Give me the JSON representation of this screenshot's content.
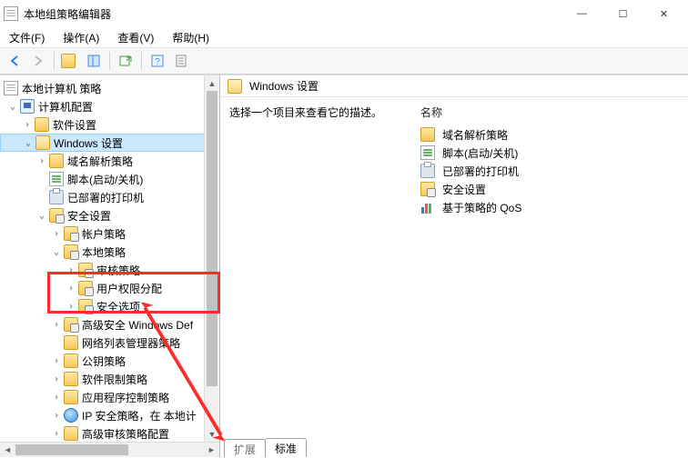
{
  "window": {
    "title": "本地组策略编辑器"
  },
  "menu": {
    "file": "文件(F)",
    "action": "操作(A)",
    "view": "查看(V)",
    "help": "帮助(H)"
  },
  "winctrl": {
    "min": "—",
    "max": "☐",
    "close": "✕"
  },
  "tree": {
    "root": "本地计算机 策略",
    "computer_config": "计算机配置",
    "software_settings": "软件设置",
    "windows_settings": "Windows 设置",
    "dns_policy": "域名解析策略",
    "scripts": "脚本(启动/关机)",
    "deployed_printers": "已部署的打印机",
    "security_settings": "安全设置",
    "account_policies": "帐户策略",
    "local_policies": "本地策略",
    "audit_policy": "审核策略",
    "user_rights": "用户权限分配",
    "security_options": "安全选项",
    "wfas": "高级安全 Windows Def",
    "nlm": "网络列表管理器策略",
    "pki": "公钥策略",
    "srp": "软件限制策略",
    "applocker": "应用程序控制策略",
    "ipsec": "IP 安全策略，在 本地计",
    "adv_audit": "高级审核策略配置"
  },
  "content": {
    "header": "Windows 设置",
    "hint": "选择一个项目来查看它的描述。",
    "col_name": "名称",
    "items": {
      "dns": "域名解析策略",
      "scripts": "脚本(启动/关机)",
      "printers": "已部署的打印机",
      "security": "安全设置",
      "qos": "基于策略的 QoS"
    }
  },
  "tabs": {
    "extended": "扩展",
    "standard": "标准"
  }
}
